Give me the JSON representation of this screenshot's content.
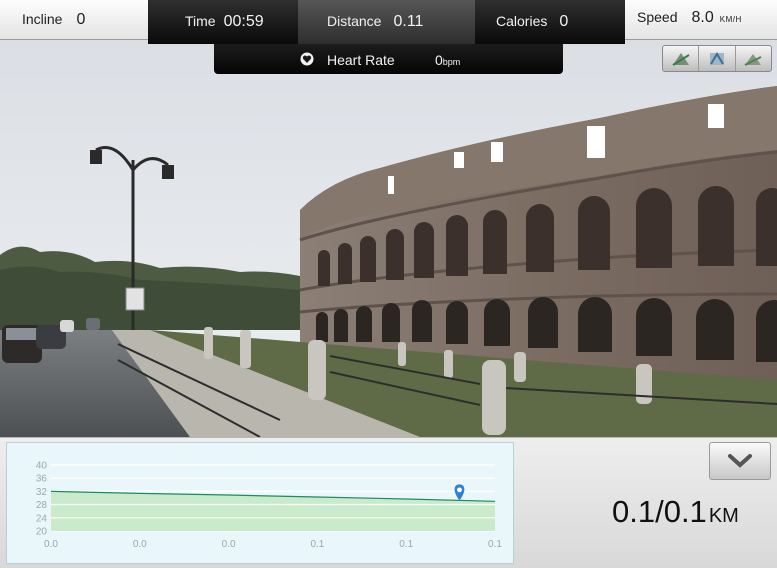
{
  "stats": {
    "incline": {
      "label": "Incline",
      "value": "0"
    },
    "time": {
      "label": "Time",
      "value": "00:59"
    },
    "distance": {
      "label": "Distance",
      "value": "0.11"
    },
    "calories": {
      "label": "Calories",
      "value": "0"
    },
    "speed": {
      "label": "Speed",
      "value": "8.0",
      "unit": "KM/H"
    }
  },
  "heart_rate": {
    "label": "Heart Rate",
    "value": "0",
    "unit": "bpm",
    "icon": "heart-rate-icon"
  },
  "view_buttons": [
    {
      "name": "view-map-icon"
    },
    {
      "name": "view-route-icon"
    },
    {
      "name": "view-street-icon"
    }
  ],
  "collapse_button": {
    "icon": "chevron-down-icon"
  },
  "progress": {
    "value": "0.1/0.1",
    "unit": "KM"
  },
  "colors": {
    "profile_line": "#1e8a63",
    "profile_fill": "#c6e8c6",
    "marker": "#2d82d8"
  },
  "chart_data": {
    "type": "area",
    "x_tick_labels": [
      "0.0",
      "0.0",
      "0.0",
      "0.1",
      "0.1",
      "0.1"
    ],
    "y_ticks": [
      20,
      24,
      28,
      32,
      36,
      40
    ],
    "ylim": [
      20,
      40
    ],
    "x": [
      0.0,
      0.02,
      0.04,
      0.06,
      0.08,
      0.1
    ],
    "values": [
      32.0,
      31.4,
      30.9,
      30.3,
      29.7,
      29.0
    ],
    "current_position_x": 0.092,
    "title": "",
    "xlabel": "",
    "ylabel": ""
  }
}
